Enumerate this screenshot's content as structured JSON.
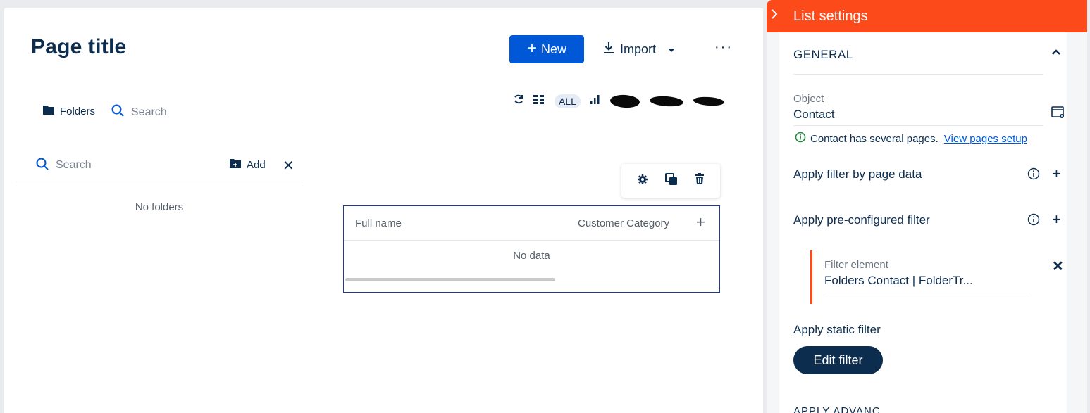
{
  "page": {
    "title": "Page title",
    "new_label": "New",
    "import_label": "Import",
    "more_label": "···"
  },
  "folders": {
    "tab_label": "Folders",
    "search_placeholder": "Search",
    "panel_search_placeholder": "Search",
    "add_label": "Add",
    "empty_text": "No folders"
  },
  "toolbar": {
    "all_label": "ALL"
  },
  "grid": {
    "columns": [
      "Full name",
      "Customer Category"
    ],
    "empty_text": "No data"
  },
  "side": {
    "title": "List settings",
    "section": "GENERAL",
    "object_label": "Object",
    "object_value": "Contact",
    "info_text": "Contact has several pages.",
    "info_link": "View pages setup",
    "filter_by_page": "Apply filter by page data",
    "preconfigured": "Apply pre-configured filter",
    "filter_element_label": "Filter element",
    "filter_element_value": "Folders Contact | FolderTr...",
    "static_filter": "Apply static filter",
    "edit_filter": "Edit filter",
    "cut_text": "APPLY ADVANC"
  },
  "colors": {
    "accent": "#fc4a1a",
    "primary": "#0058d6",
    "navy": "#0d2d4f"
  }
}
